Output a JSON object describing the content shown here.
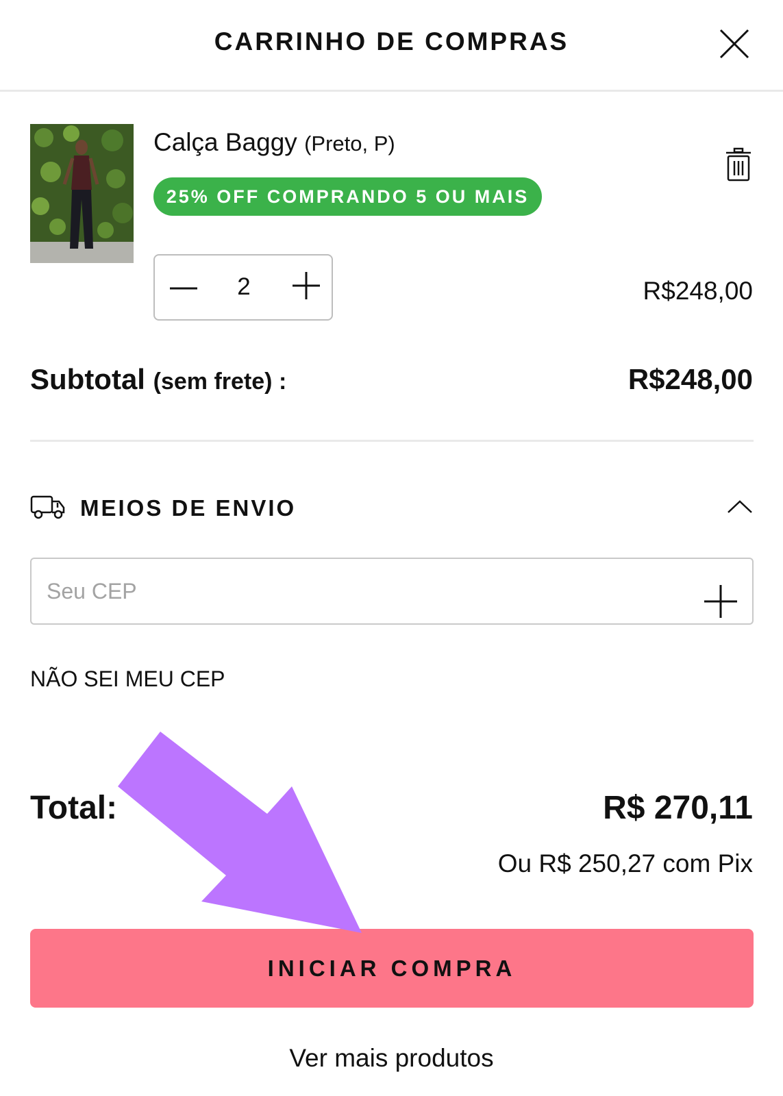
{
  "header": {
    "title": "CARRINHO DE COMPRAS",
    "close_icon": "close-icon"
  },
  "cart_item": {
    "name": "Calça Baggy",
    "variant": "(Preto, P)",
    "promo_badge": "25% OFF COMPRANDO 5 OU MAIS",
    "quantity": "2",
    "price": "R$248,00",
    "image_icon": "product-photo",
    "remove_icon": "trash-icon"
  },
  "subtotal": {
    "label": "Subtotal",
    "sub_label": "(sem frete) :",
    "value": "R$248,00"
  },
  "shipping": {
    "title": "MEIOS DE ENVIO",
    "icon": "truck-icon",
    "toggle_icon": "chevron-up-icon",
    "cep_placeholder": "Seu CEP",
    "no_cep_link": "NÃO SEI MEU CEP"
  },
  "total": {
    "label": "Total:",
    "value": "R$ 270,11",
    "pix_text": "Ou R$ 250,27 com Pix"
  },
  "actions": {
    "checkout_label": "INICIAR COMPRA",
    "more_products_label": "Ver mais produtos"
  },
  "colors": {
    "promo_green": "#3bb24a",
    "checkout_pink": "#fd7689",
    "annotation_arrow": "#bc75ff"
  }
}
